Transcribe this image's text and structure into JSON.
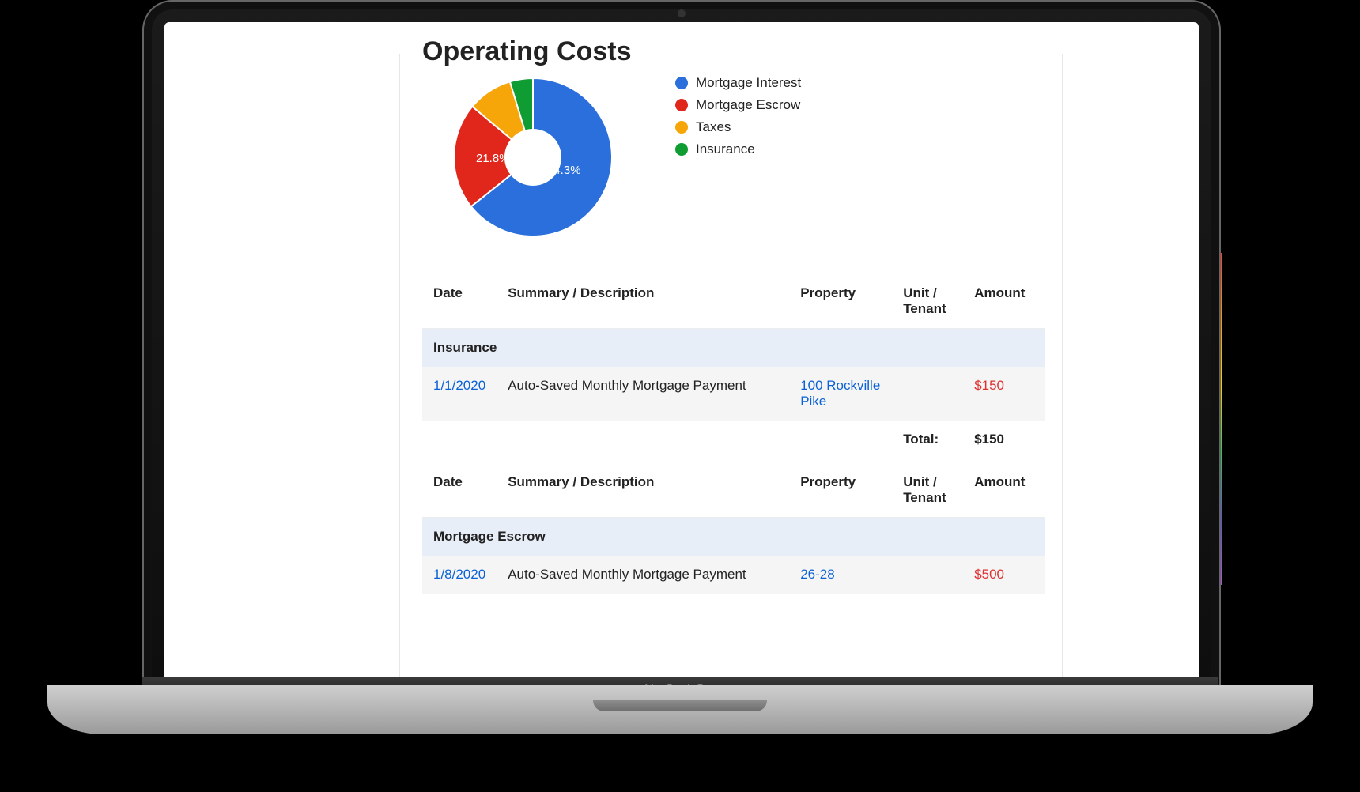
{
  "device_brand": "MacBook Pro",
  "page_title": "Operating Costs",
  "chart_data": {
    "type": "pie",
    "title": "Operating Costs",
    "series": [
      {
        "name": "Mortgage Interest",
        "value": 64.3,
        "label": "64.3%",
        "color": "#2a6fdb"
      },
      {
        "name": "Mortgage Escrow",
        "value": 21.8,
        "label": "21.8%",
        "color": "#e1261c"
      },
      {
        "name": "Taxes",
        "value": 9.2,
        "label": "",
        "color": "#f6a609"
      },
      {
        "name": "Insurance",
        "value": 4.7,
        "label": "",
        "color": "#0f9d33"
      }
    ],
    "inner_radius_pct": 35
  },
  "legend": [
    {
      "label": "Mortgage Interest",
      "color": "#2a6fdb"
    },
    {
      "label": "Mortgage Escrow",
      "color": "#e1261c"
    },
    {
      "label": "Taxes",
      "color": "#f6a609"
    },
    {
      "label": "Insurance",
      "color": "#0f9d33"
    }
  ],
  "columns": {
    "date": "Date",
    "summary": "Summary / Description",
    "property": "Property",
    "unit": "Unit / Tenant",
    "amount": "Amount"
  },
  "sections": [
    {
      "title": "Insurance",
      "rows": [
        {
          "date": "1/1/2020",
          "summary": "Auto-Saved Monthly Mortgage Payment",
          "property": "100 Rockville Pike",
          "unit": "",
          "amount": "$150"
        }
      ],
      "total_label": "Total:",
      "total_amount": "$150"
    },
    {
      "title": "Mortgage Escrow",
      "rows": [
        {
          "date": "1/8/2020",
          "summary": "Auto-Saved Monthly Mortgage Payment",
          "property": "26-28",
          "unit": "",
          "amount": "$500"
        }
      ]
    }
  ]
}
